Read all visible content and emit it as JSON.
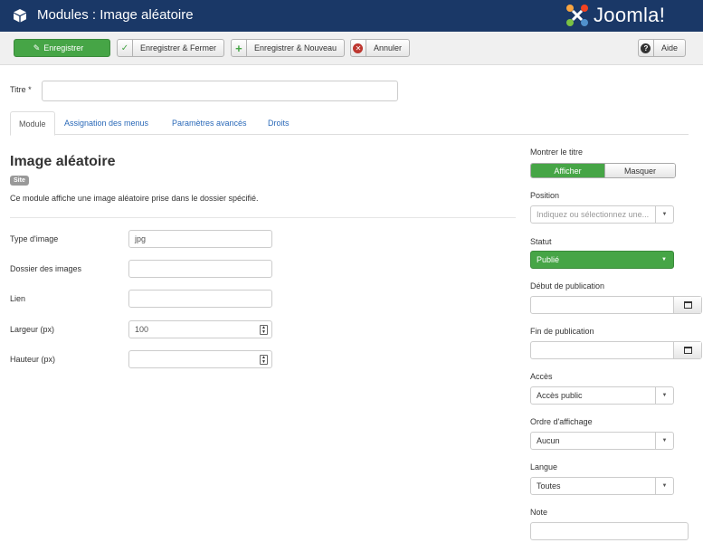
{
  "header": {
    "title": "Modules : Image aléatoire",
    "brand": "Joomla!"
  },
  "toolbar": {
    "save": "Enregistrer",
    "save_close": "Enregistrer & Fermer",
    "save_new": "Enregistrer & Nouveau",
    "cancel": "Annuler",
    "help": "Aide"
  },
  "title_field": {
    "label": "Titre *",
    "value": ""
  },
  "tabs": [
    "Module",
    "Assignation des menus",
    "Paramètres avancés",
    "Droits"
  ],
  "module": {
    "heading": "Image aléatoire",
    "badge": "Site",
    "description": "Ce module affiche une image aléatoire prise dans le dossier spécifié."
  },
  "fields": [
    {
      "label": "Type d'image",
      "value": "jpg"
    },
    {
      "label": "Dossier des images",
      "value": ""
    },
    {
      "label": "Lien",
      "value": ""
    },
    {
      "label": "Largeur (px)",
      "value": "100"
    },
    {
      "label": "Hauteur (px)",
      "value": ""
    }
  ],
  "sidebar": {
    "show_title": {
      "label": "Montrer le titre",
      "on": "Afficher",
      "off": "Masquer"
    },
    "position": {
      "label": "Position",
      "placeholder": "Indiquez ou sélectionnez une..."
    },
    "status": {
      "label": "Statut",
      "value": "Publié"
    },
    "publish_up": {
      "label": "Début de publication",
      "value": ""
    },
    "publish_down": {
      "label": "Fin de publication",
      "value": ""
    },
    "access": {
      "label": "Accès",
      "value": "Accès public"
    },
    "ordering": {
      "label": "Ordre d'affichage",
      "value": "Aucun"
    },
    "language": {
      "label": "Langue",
      "value": "Toutes"
    },
    "note": {
      "label": "Note",
      "value": ""
    }
  },
  "colors": {
    "header": "#1a3867",
    "success": "#46a546",
    "danger": "#bd362f",
    "link": "#2a69b8"
  }
}
